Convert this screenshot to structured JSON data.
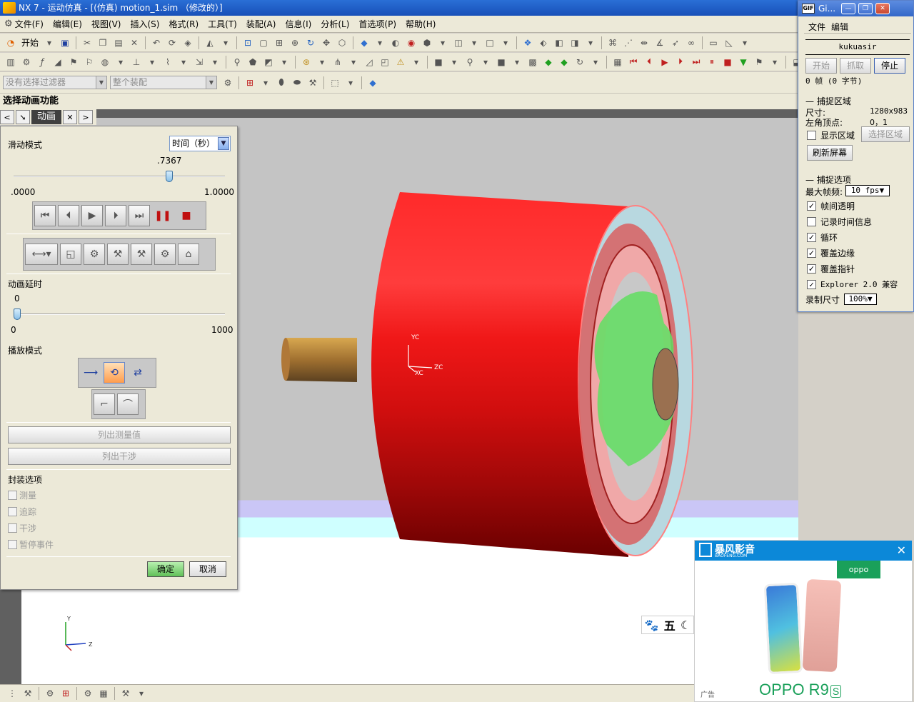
{
  "window": {
    "title": "NX 7 - 运动仿真 - [(仿真) motion_1.sim （修改的）]"
  },
  "menu": [
    "文件(F)",
    "编辑(E)",
    "视图(V)",
    "插入(S)",
    "格式(R)",
    "工具(T)",
    "装配(A)",
    "信息(I)",
    "分析(L)",
    "首选项(P)",
    "帮助(H)"
  ],
  "toolbar": {
    "start_label": "开始",
    "filter_placeholder": "没有选择过滤器",
    "assembly_placeholder": "整个装配"
  },
  "selection_heading": "选择动画功能",
  "tabs": {
    "active": "动画"
  },
  "dialog": {
    "slide_mode_label": "滑动模式",
    "slide_mode_value": "时间（秒）",
    "slider_value": ".7367",
    "slider_fraction": 0.7367,
    "slider_min": ".0000",
    "slider_max": "1.0000",
    "delay_label": "动画延时",
    "delay_value": "0",
    "delay_fraction": 0.0,
    "delay_min": "0",
    "delay_max": "1000",
    "play_mode_label": "播放模式",
    "list_measure": "列出测量值",
    "list_interference": "列出干涉",
    "pack_options_label": "封装选项",
    "pack_options": [
      "测量",
      "追踪",
      "干涉",
      "暂停事件"
    ],
    "ok_label": "确定",
    "cancel_label": "取消"
  },
  "viewport": {
    "csys_labels": {
      "yc": "YC",
      "xc": "XC",
      "zc": "ZC"
    },
    "triad_labels": {
      "y": "Y",
      "z": "Z"
    }
  },
  "gif_app": {
    "title": "Gi...",
    "menu": [
      "文件",
      "编辑"
    ],
    "user": "kukuasir",
    "buttons": {
      "start": "开始",
      "capture": "抓取",
      "stop": "停止"
    },
    "frames_text": "0 帧 (0 字节)",
    "capture_area_title": "捕捉区域",
    "size_label": "尺寸:",
    "size_value": "1280x983",
    "topleft_label": "左角顶点:",
    "topleft_value": "0，1",
    "show_area": "显示区域",
    "select_area": "选择区域",
    "refresh": "刷新屏幕",
    "capture_options_title": "捕捉选项",
    "max_fps_label": "最大帧频:",
    "max_fps_value": "10 fps",
    "options": [
      {
        "label": "帧间透明",
        "checked": true
      },
      {
        "label": "记录时间信息",
        "checked": false
      },
      {
        "label": "循环",
        "checked": true
      },
      {
        "label": "覆盖边缘",
        "checked": true
      },
      {
        "label": "覆盖指针",
        "checked": true
      },
      {
        "label": "Explorer 2.0 兼容",
        "checked": true
      }
    ],
    "record_size_label": "录制尺寸",
    "record_size_value": "100%"
  },
  "ad": {
    "brand": "暴风影音",
    "brand_sub": "BAOFENG.COM",
    "oppo_logo": "oppo",
    "tag": "广告",
    "product_name": "OPPO R9",
    "product_suffix": "S"
  },
  "ime": {
    "char": "五"
  },
  "colors": {
    "title_blue": "#1850b8",
    "drum_red": "#ff2020",
    "shaft": "#c08a40",
    "gear_green": "#66dd66",
    "ad_blue": "#0c88d8",
    "oppo_green": "#1aa05a"
  }
}
